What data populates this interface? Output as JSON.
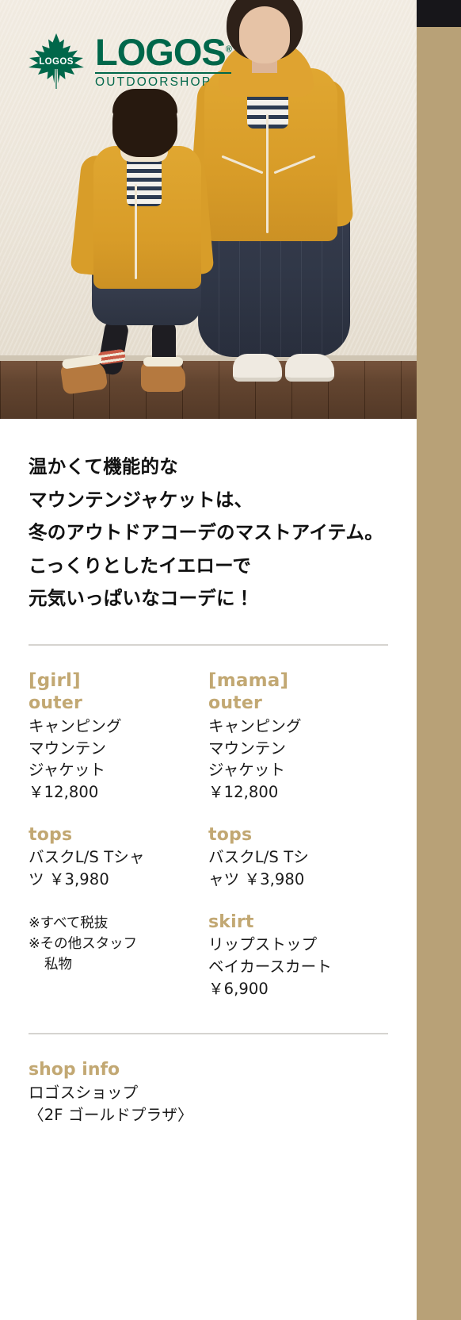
{
  "brand": {
    "leaf_mark_text": "LOGOS",
    "wordmark": "LOGOS",
    "registered": "®",
    "tagline": "OUTDOORSHOP",
    "green": "#00674a"
  },
  "accent_color": "#c2a873",
  "hero": {
    "alt": "mother-and-daughter-in-yellow-mountain-jackets"
  },
  "headline": {
    "line1": "温かくて機能的な",
    "line2": "マウンテンジャケットは、",
    "line3": "冬のアウトドアコーデのマストアイテム。",
    "line4": "こっくりとしたイエローで",
    "line5": "元気いっぱいなコーデに！"
  },
  "columns": [
    {
      "tag": "[girl]",
      "sections": [
        {
          "category": "outer",
          "lines": [
            "キャンピング",
            "マウンテン",
            "ジャケット",
            "￥12,800"
          ]
        },
        {
          "category": "tops",
          "lines": [
            "バスクL/S Tシャ",
            "ツ ￥3,980"
          ]
        }
      ],
      "notes": [
        "※すべて税抜",
        "※その他スタッフ",
        "私物"
      ]
    },
    {
      "tag": "[mama]",
      "sections": [
        {
          "category": "outer",
          "lines": [
            "キャンピング",
            "マウンテン",
            "ジャケット",
            "￥12,800"
          ]
        },
        {
          "category": "tops",
          "lines": [
            "バスクL/S Tシ",
            "ャツ ￥3,980"
          ]
        },
        {
          "category": "skirt",
          "lines": [
            "リップストップ",
            "ベイカースカート",
            "￥6,900"
          ]
        }
      ],
      "notes": []
    }
  ],
  "shop_info": {
    "title": "shop info",
    "name": "ロゴスショップ",
    "location": "〈2F  ゴールドプラザ〉"
  }
}
